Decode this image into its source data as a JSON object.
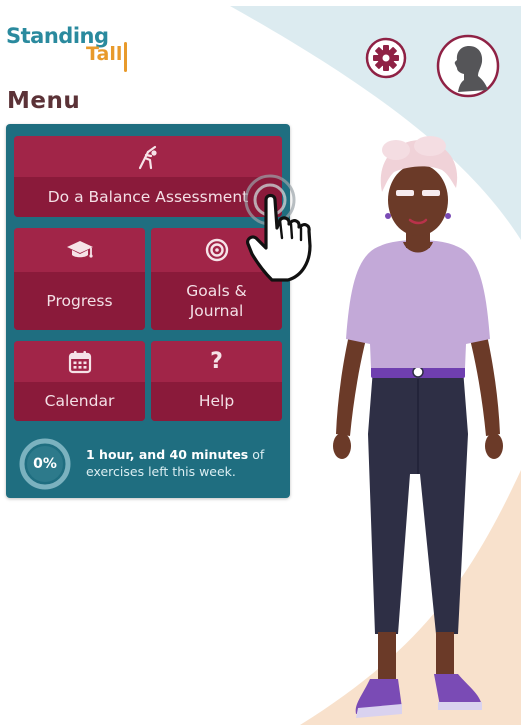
{
  "app": {
    "logo_line1": "Standing",
    "logo_line2": "Tall",
    "menu_title": "Menu"
  },
  "header": {
    "settings_icon": "gear-icon",
    "profile_icon": "user-silhouette-icon"
  },
  "menu": {
    "balance": {
      "label": "Do a Balance Assessment",
      "icon": "stretching-person-icon"
    },
    "progress": {
      "label": "Progress",
      "icon": "graduation-cap-icon"
    },
    "goals": {
      "label": "Goals &\nJournal",
      "icon": "target-icon"
    },
    "calendar": {
      "label": "Calendar",
      "icon": "calendar-icon"
    },
    "help": {
      "label": "Help",
      "icon": "question-mark-icon",
      "glyph": "?"
    }
  },
  "status": {
    "percent": "0%",
    "percent_value": 0,
    "time_left": "1 hour, and 40 minutes",
    "suffix_line1": " of",
    "suffix_line2": "exercises left this week."
  },
  "colors": {
    "teal_panel": "#1f6e80",
    "tile": "#9b2041",
    "logo_teal": "#2a8a9e",
    "logo_orange": "#e89a2b",
    "title": "#5b3237",
    "accent": "#8f2245"
  }
}
